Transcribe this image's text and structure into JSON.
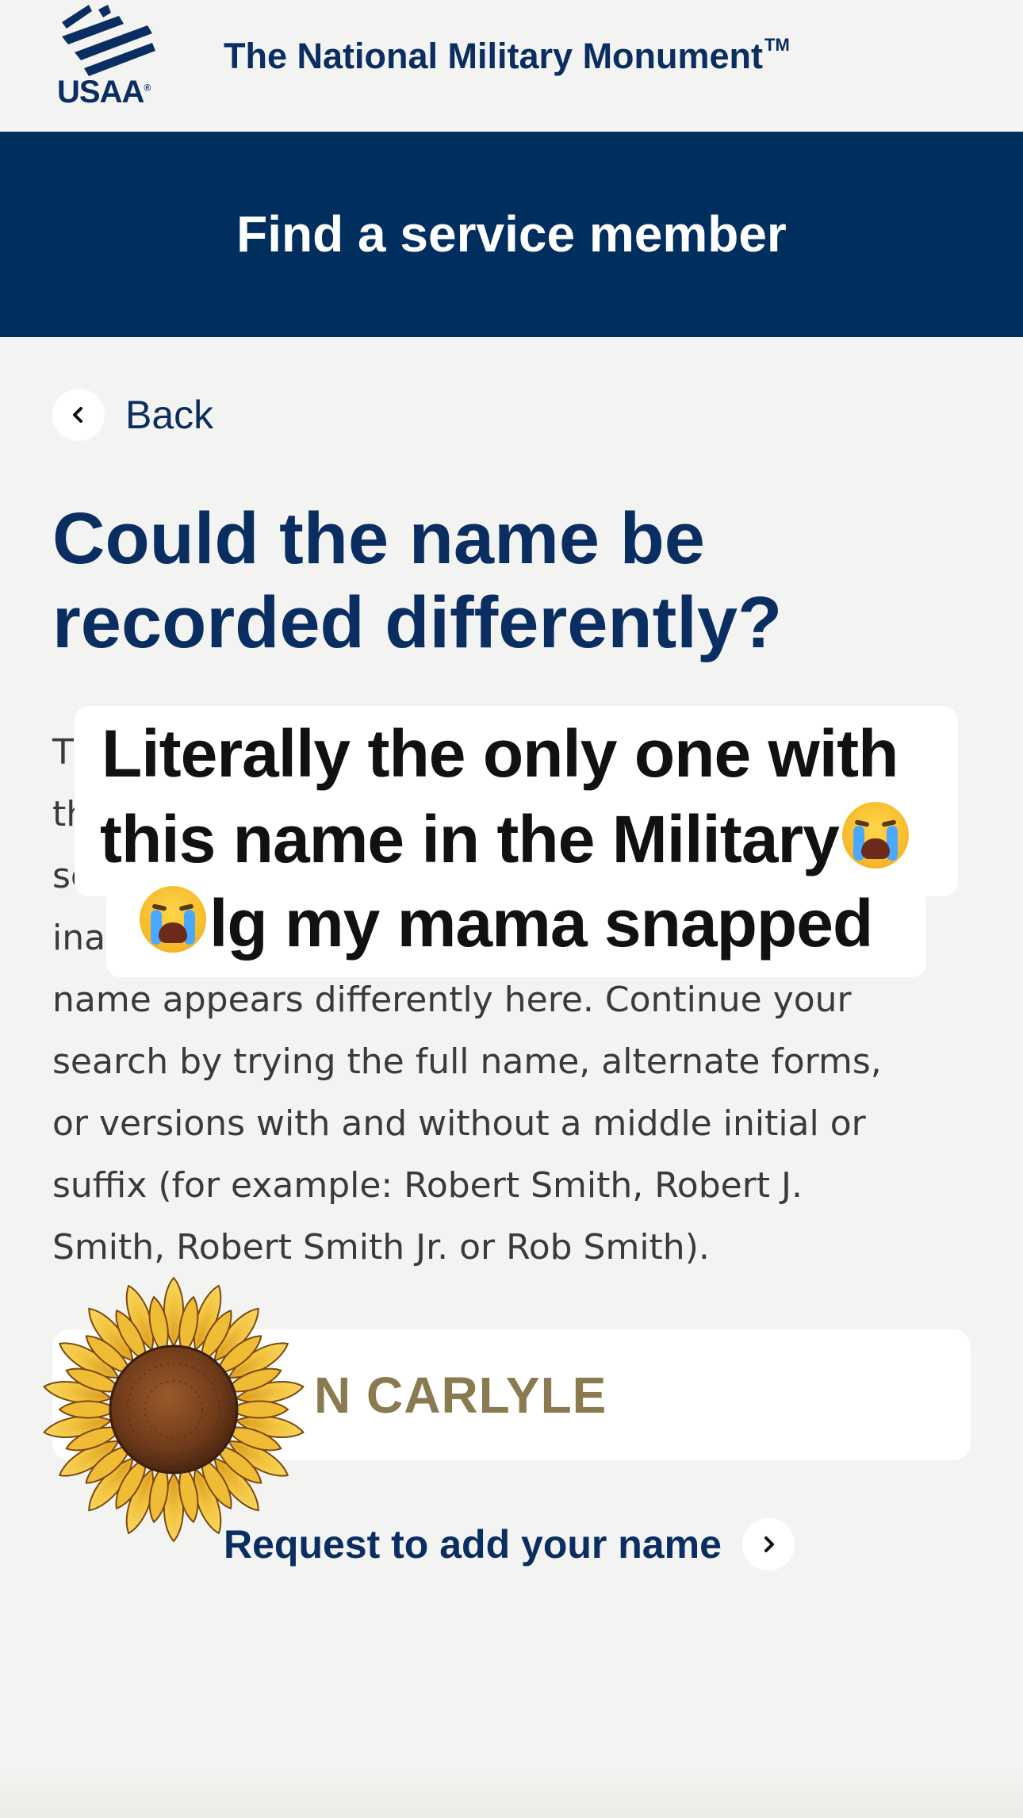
{
  "header": {
    "logo_text": "USAA",
    "logo_reg": "®",
    "site_title": "The National Military Monument",
    "site_title_tm": "TM"
  },
  "banner": {
    "title": "Find a service member"
  },
  "back": {
    "label": "Back",
    "icon": "chevron-left-icon"
  },
  "main": {
    "heading": "Could the name be recorded differently?",
    "body_lines": [
      "T",
      "th",
      "se",
      "ina",
      "name appears differently here. Continue your",
      "search by trying the full name, alternate forms,",
      "or versions with and without a middle initial or",
      "suffix (for example: Robert Smith, Robert J.",
      "Smith, Robert Smith Jr. or Rob Smith)."
    ]
  },
  "caption": {
    "line1": "Literally the only one with",
    "line2": "this name in the Military",
    "line3": "lg my mama snapped",
    "emoji": "loudly-crying-face-emoji"
  },
  "result": {
    "name": "N CARLYLE"
  },
  "sticker": {
    "icon": "sunflower-sticker"
  },
  "request": {
    "label": "Request to add your name",
    "icon": "chevron-right-icon"
  },
  "colors": {
    "navy": "#0a2e61",
    "banner": "#002e5f",
    "background": "#f3f3f1",
    "name_text": "#8a7a50"
  }
}
